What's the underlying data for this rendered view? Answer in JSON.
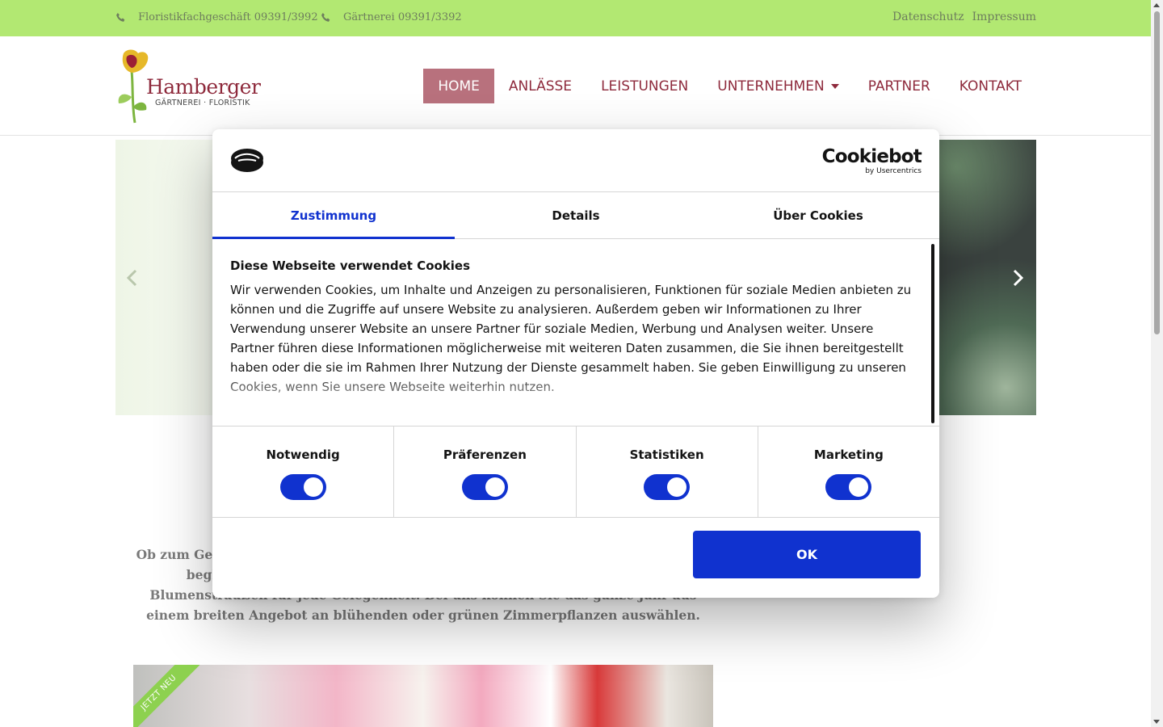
{
  "topbar": {
    "contact1": "Floristikfachgeschäft 09391/3992",
    "contact2": "Gärtnerei 09391/3392",
    "legal": [
      "Datenschutz",
      "Impressum"
    ]
  },
  "header": {
    "logo_brand": "Hamberger",
    "logo_sub": "GÄRTNEREI · FLORISTIK",
    "nav": [
      {
        "label": "HOME"
      },
      {
        "label": "ANLÄSSE"
      },
      {
        "label": "LEISTUNGEN"
      },
      {
        "label": "UNTERNEHMEN"
      },
      {
        "label": "PARTNER"
      },
      {
        "label": "KONTAKT"
      }
    ]
  },
  "intro": {
    "text": "Ob zum Geburtstag, zur Hochzeit oder einfach nur, um einen lieben Menschen zu beglücken – bei uns finden Sie eine große Auswahl an individuellen Blumensträußen für jede Gelegenheit. Bei uns können Sie das ganze Jahr aus einem breiten Angebot an blühenden oder grünen Zimmerpflanzen auswählen."
  },
  "promo": {
    "ribbon": "JETZT NEU"
  },
  "cookie": {
    "brand_big": "Cookiebot",
    "brand_small": "by Usercentrics",
    "tabs": [
      "Zustimmung",
      "Details",
      "Über Cookies"
    ],
    "heading": "Diese Webseite verwendet Cookies",
    "text": "Wir verwenden Cookies, um Inhalte und Anzeigen zu personalisieren, Funktionen für soziale Medien anbieten zu können und die Zugriffe auf unsere Website zu analysieren. Außerdem geben wir Informationen zu Ihrer Verwendung unserer Website an unsere Partner für soziale Medien, Werbung und Analysen weiter. Unsere Partner führen diese Informationen möglicherweise mit weiteren Daten zusammen, die Sie ihnen bereitgestellt haben oder die sie im Rahmen Ihrer Nutzung der Dienste gesammelt haben. Sie geben Einwilligung zu unseren Cookies, wenn Sie unsere Webseite weiterhin nutzen.",
    "categories": [
      {
        "label": "Notwendig"
      },
      {
        "label": "Präferenzen"
      },
      {
        "label": "Statistiken"
      },
      {
        "label": "Marketing"
      }
    ],
    "ok_label": "OK",
    "accent": "#1032cf"
  },
  "colors": {
    "topbar": "#b2e872",
    "brand": "#8e2a3c",
    "nav_active_bg": "#b8717d"
  }
}
